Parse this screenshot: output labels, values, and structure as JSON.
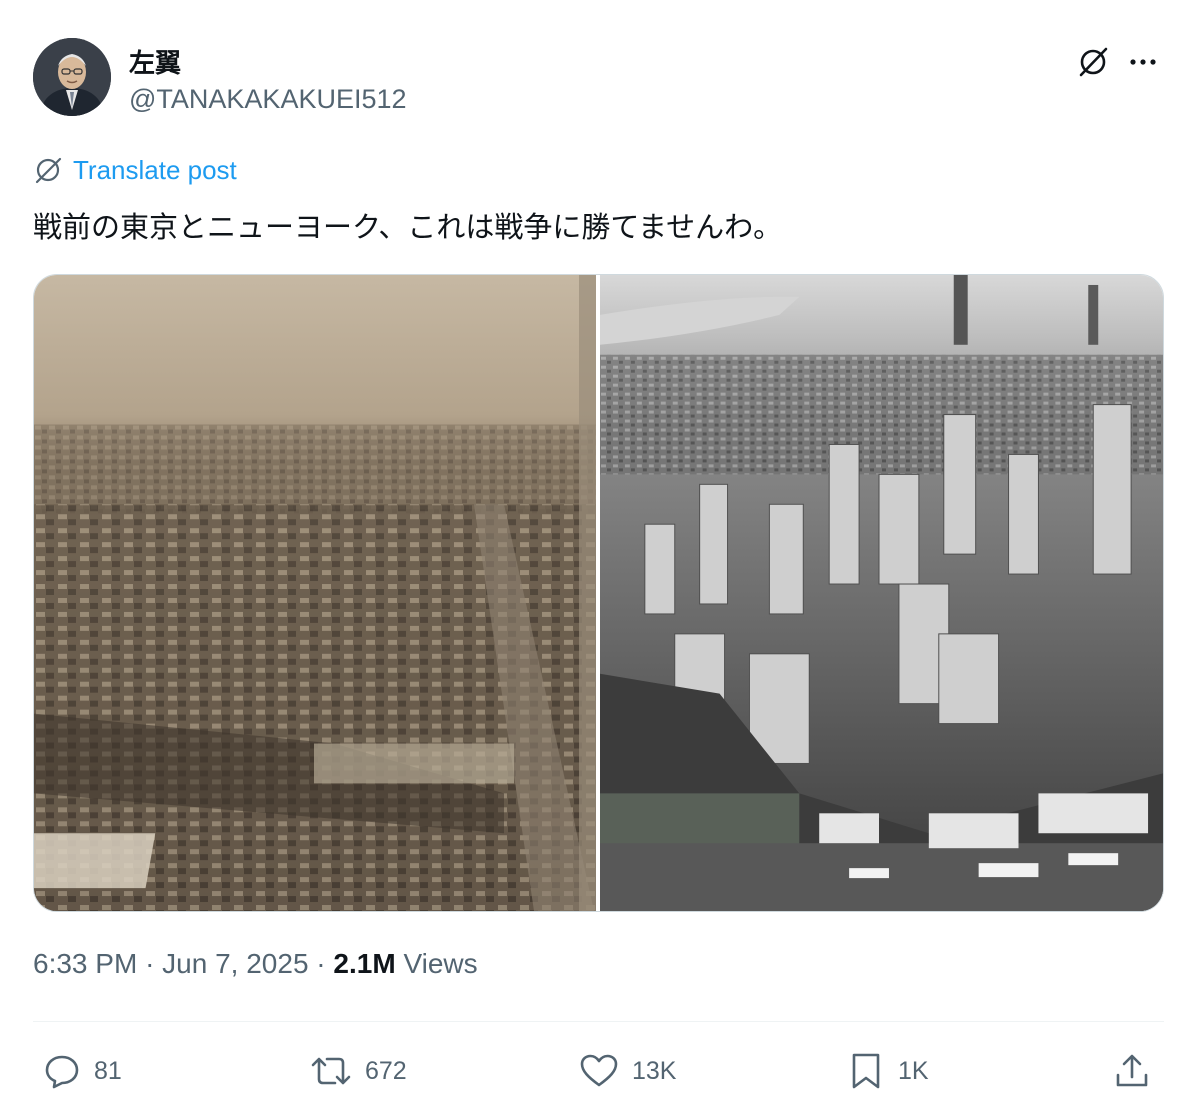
{
  "author": {
    "display_name": "左翼",
    "handle": "@TANAKAKAKUEI512"
  },
  "header_icons": {
    "grok": "grok-icon",
    "more": "more-icon"
  },
  "translate": {
    "label": "Translate post",
    "icon": "globe-icon"
  },
  "tweet": {
    "text": "戦前の東京とニューヨーク、これは戦争に勝てませんわ。"
  },
  "media": {
    "images": [
      {
        "name": "tokyo-aerial-photo",
        "tone": "sepia"
      },
      {
        "name": "new-york-aerial-photo",
        "tone": "grayscale"
      }
    ]
  },
  "meta": {
    "time": "6:33 PM",
    "separator": "·",
    "date": "Jun 7, 2025",
    "views_count": "2.1M",
    "views_label": "Views"
  },
  "actions": {
    "reply": {
      "icon": "reply-icon",
      "count": "81"
    },
    "repost": {
      "icon": "repost-icon",
      "count": "672"
    },
    "like": {
      "icon": "heart-icon",
      "count": "13K"
    },
    "bookmark": {
      "icon": "bookmark-icon",
      "count": "1K"
    },
    "share": {
      "icon": "share-icon"
    }
  },
  "colors": {
    "text_primary": "#0f1419",
    "text_secondary": "#536471",
    "link": "#1d9bf0",
    "border": "#cfd9de"
  }
}
